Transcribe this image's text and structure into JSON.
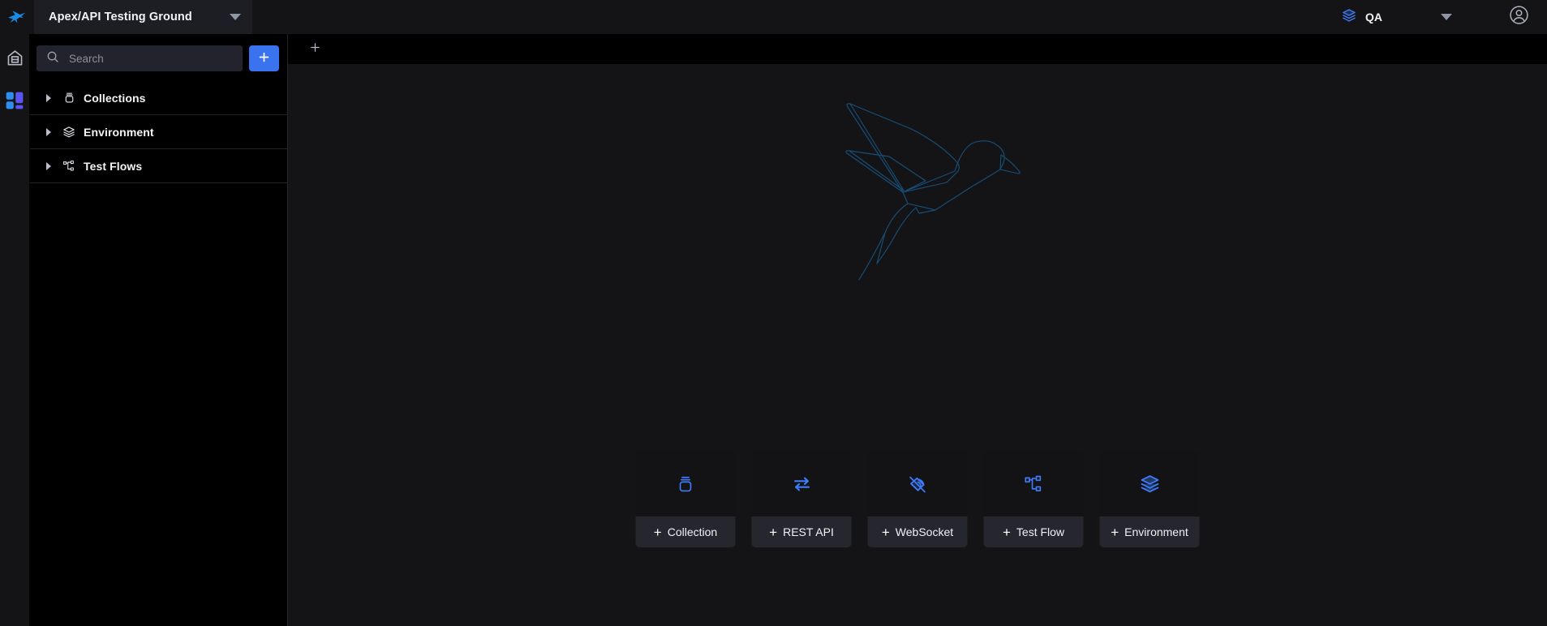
{
  "header": {
    "logo_icon": "hummingbird-logo",
    "project": {
      "name": "Apex/API Testing Ground",
      "caret_icon": "chevron-down-icon"
    },
    "environment": {
      "icon": "layers-icon",
      "name": "QA",
      "caret_icon": "chevron-down-icon"
    },
    "account_icon": "user-account-icon"
  },
  "rail": {
    "items": [
      {
        "icon": "home-icon",
        "label": "Home"
      },
      {
        "icon": "grid-apps-icon",
        "label": "Apps"
      }
    ]
  },
  "sidebar": {
    "search": {
      "icon": "search-icon",
      "value": "",
      "placeholder": "Search"
    },
    "add_button": {
      "icon": "plus-icon",
      "label": "+"
    },
    "tree": [
      {
        "label": "Collections",
        "icon": "collection-jar-icon",
        "expander": "triangle-right-icon",
        "expanded": false
      },
      {
        "label": "Environment",
        "icon": "layers-icon",
        "expander": "triangle-right-icon",
        "expanded": false
      },
      {
        "label": "Test Flows",
        "icon": "flow-nodes-icon",
        "expander": "triangle-right-icon",
        "expanded": false
      }
    ]
  },
  "main": {
    "tabstrip": {
      "new_tab_icon": "plus-icon",
      "new_tab_label": "+"
    },
    "watermark": {
      "icon": "hummingbird-outline-watermark"
    },
    "cards": [
      {
        "label": "Collection",
        "plus": "+",
        "icon": "collection-jar-icon"
      },
      {
        "label": "REST API",
        "plus": "+",
        "icon": "bidirectional-arrows-icon"
      },
      {
        "label": "WebSocket",
        "plus": "+",
        "icon": "websocket-plug-icon"
      },
      {
        "label": "Test Flow",
        "plus": "+",
        "icon": "flow-nodes-icon"
      },
      {
        "label": "Environment",
        "plus": "+",
        "icon": "layers-icon"
      }
    ]
  },
  "colors": {
    "accent_blue": "#3b72f0",
    "icon_blue": "#3d7bf7",
    "header_bg": "#141416",
    "sidebar_bg": "#000000",
    "canvas_bg": "#141416",
    "card_bg": "#131316",
    "card_label_bg": "#26262f",
    "search_bg": "#23232e",
    "watermark_stroke": "#17527f",
    "text_primary": "#f2f3f5",
    "text_muted": "#8b8f99"
  }
}
